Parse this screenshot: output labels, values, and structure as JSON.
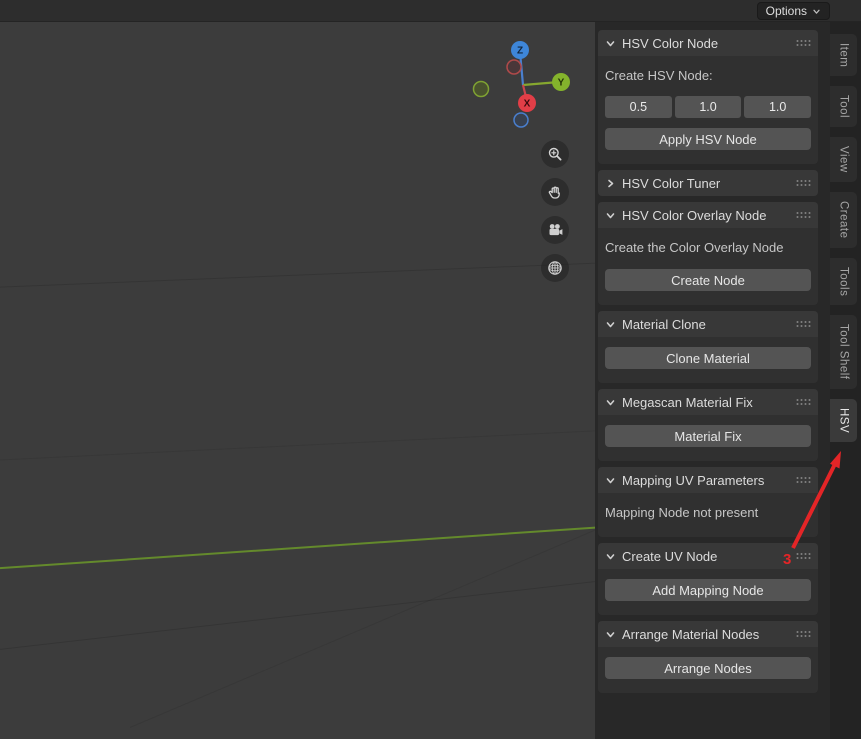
{
  "header": {
    "options_label": "Options"
  },
  "viewport": {
    "gizmo": {
      "x_label": "X",
      "y_label": "Y",
      "z_label": "Z"
    },
    "nav_buttons": [
      {
        "name": "zoom"
      },
      {
        "name": "pan"
      },
      {
        "name": "camera"
      },
      {
        "name": "perspective-grid"
      }
    ]
  },
  "sidebar": {
    "panels": [
      {
        "title": "HSV Color Node",
        "expanded": true,
        "label": "Create HSV Node:",
        "fields": [
          "0.5",
          "1.0",
          "1.0"
        ],
        "button": "Apply HSV Node"
      },
      {
        "title": "HSV Color Tuner",
        "expanded": false
      },
      {
        "title": "HSV Color Overlay Node",
        "expanded": true,
        "label": "Create the Color Overlay Node",
        "button": "Create Node"
      },
      {
        "title": "Material Clone",
        "expanded": true,
        "button": "Clone Material"
      },
      {
        "title": "Megascan Material Fix",
        "expanded": true,
        "button": "Material Fix"
      },
      {
        "title": "Mapping UV Parameters",
        "expanded": true,
        "label": "Mapping Node not present"
      },
      {
        "title": "Create UV Node",
        "expanded": true,
        "button": "Add Mapping Node"
      },
      {
        "title": "Arrange Material Nodes",
        "expanded": true,
        "button": "Arrange Nodes"
      }
    ]
  },
  "tabs": {
    "items": [
      "Item",
      "Tool",
      "View",
      "Create",
      "Tools",
      "Tool Shelf",
      "HSV"
    ],
    "active": "HSV"
  },
  "annotation": {
    "number": "3"
  },
  "icons": {
    "options_chevron": "chevron-down",
    "panel_chevron": "chevron-down",
    "panel_grip": "drag-dots",
    "nav": [
      "magnifier-plus",
      "hand",
      "movie-camera",
      "grid-sphere"
    ]
  },
  "colors": {
    "axis_x": "#e23e47",
    "axis_y": "#84b32c",
    "axis_z": "#3e86d8",
    "grid_axis_green": "#648a2c",
    "annotation_red": "#e42527",
    "button_bg": "#545454",
    "panel_header_bg": "#383838",
    "panel_body_bg": "#303030"
  }
}
